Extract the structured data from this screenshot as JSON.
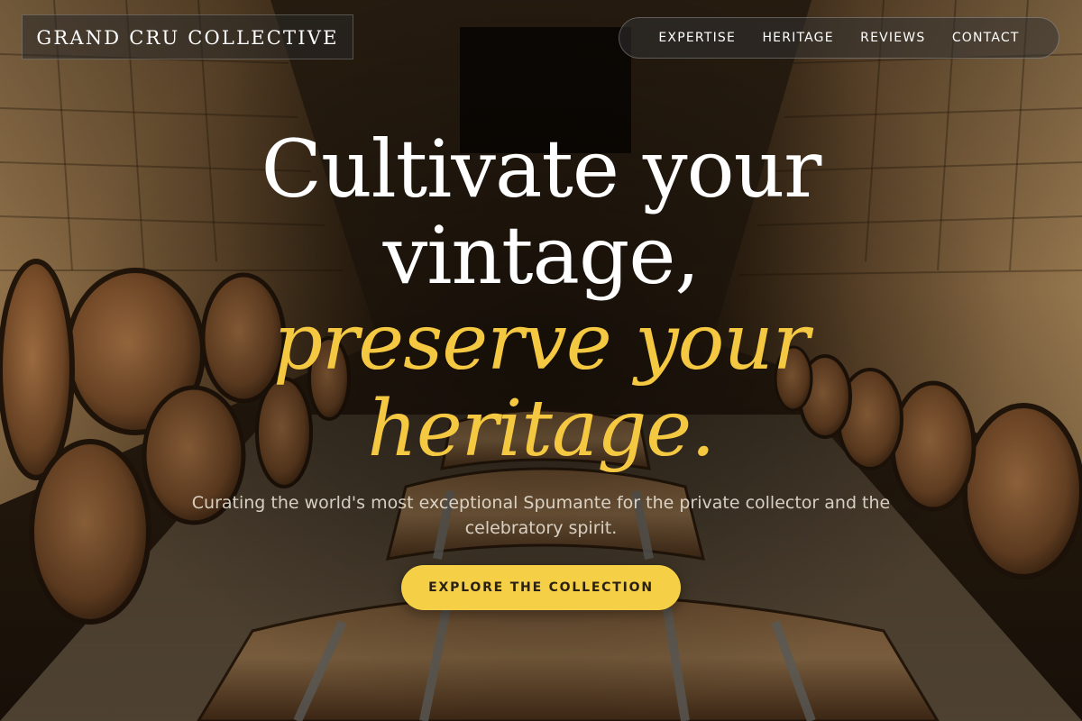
{
  "brand": {
    "name": "GRAND CRU COLLECTIVE"
  },
  "nav": {
    "items": [
      {
        "label": "EXPERTISE"
      },
      {
        "label": "HERITAGE"
      },
      {
        "label": "REVIEWS"
      },
      {
        "label": "CONTACT"
      }
    ]
  },
  "hero": {
    "line1": "Cultivate your",
    "line2": "vintage,",
    "line3": "preserve your",
    "line4": "heritage.",
    "subtitle": "Curating the world's most exceptional Spumante for the private collector and the celebratory spirit.",
    "cta_label": "EXPLORE THE COLLECTION"
  },
  "colors": {
    "accent": "#f5cf45",
    "headline_accent": "#f5c842",
    "text": "#ffffff"
  }
}
